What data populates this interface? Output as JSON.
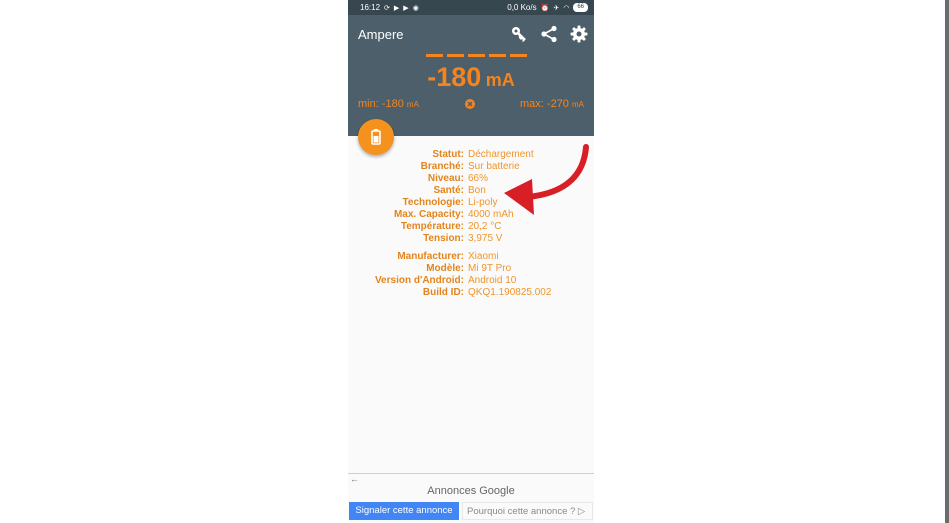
{
  "status_bar": {
    "time": "16:12",
    "network_speed": "0,0 Ko/s",
    "battery": "66",
    "icons": [
      "sync-icon",
      "play-icon",
      "play-icon",
      "location-icon",
      "alarm-icon",
      "airplane-icon",
      "wifi-icon",
      "battery-icon"
    ]
  },
  "app": {
    "title": "Ampere",
    "toolbar_icons": [
      "key-icon",
      "share-icon",
      "gear-icon"
    ],
    "reading": {
      "value": "-180",
      "unit": "mA"
    },
    "min": {
      "label": "min: -180",
      "unit": "mA"
    },
    "max": {
      "label": "max: -270",
      "unit": "mA"
    },
    "accent_color": "#f5841f",
    "header_color": "#4c5f6a"
  },
  "battery_info": [
    {
      "label": "Statut:",
      "value": "Déchargement"
    },
    {
      "label": "Branché:",
      "value": "Sur batterie"
    },
    {
      "label": "Niveau:",
      "value": "66%"
    },
    {
      "label": "Santé:",
      "value": "Bon"
    },
    {
      "label": "Technologie:",
      "value": "Li-poly"
    },
    {
      "label": "Max. Capacity:",
      "value": "4000 mAh"
    },
    {
      "label": "Température:",
      "value": "20,2 °C"
    },
    {
      "label": "Tension:",
      "value": "3,975 V"
    }
  ],
  "device_info": [
    {
      "label": "Manufacturer:",
      "value": "Xiaomi"
    },
    {
      "label": "Modèle:",
      "value": "Mi 9T Pro"
    },
    {
      "label": "Version d'Android:",
      "value": "Android 10"
    },
    {
      "label": "Build ID:",
      "value": "QKQ1.190825.002"
    }
  ],
  "ads": {
    "header": "Annonces Google",
    "back_glyph": "←",
    "report_label": "Signaler cette annonce",
    "why_label": "Pourquoi cette annonce ? ▷"
  }
}
